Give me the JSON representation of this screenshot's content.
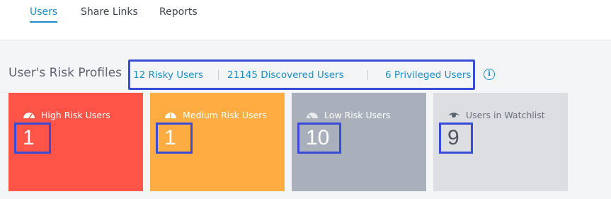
{
  "tabs": [
    {
      "label": "Users",
      "active": true
    },
    {
      "label": "Share Links",
      "active": false
    },
    {
      "label": "Reports",
      "active": false
    }
  ],
  "section": {
    "title": "User's Risk Profiles",
    "links": [
      {
        "label": "12 Risky Users"
      },
      {
        "label": "21145 Discovered Users"
      },
      {
        "label": "6 Privileged Users"
      }
    ],
    "info_icon": "info-icon"
  },
  "cards": [
    {
      "label": "High Risk Users",
      "count": "1",
      "color": "#ff5447",
      "icon": "gauge-high-icon"
    },
    {
      "label": "Medium Risk Users",
      "count": "1",
      "color": "#ffad42",
      "icon": "gauge-medium-icon"
    },
    {
      "label": "Low Risk Users",
      "count": "10",
      "color": "#a9b0bb",
      "icon": "gauge-low-icon"
    },
    {
      "label": "Users in Watchlist",
      "count": "9",
      "color": "#dcdee2",
      "icon": "eye-icon"
    }
  ],
  "colors": {
    "accent": "#1a8fc9",
    "highlight_border": "#3a4bd6"
  }
}
